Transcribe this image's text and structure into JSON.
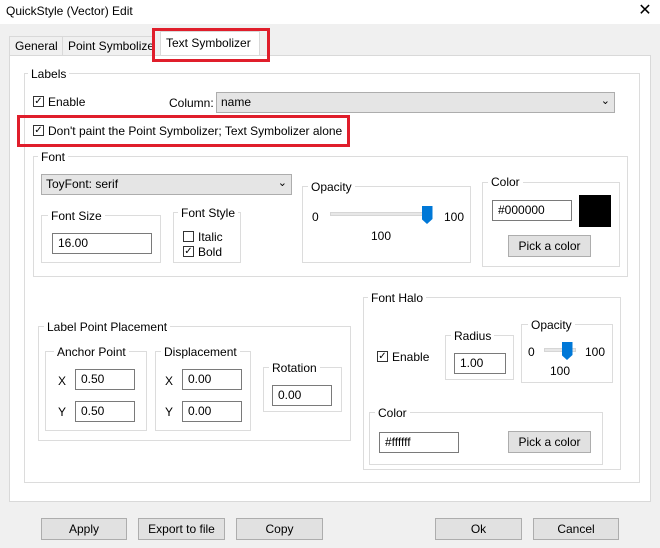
{
  "window": {
    "title": "QuickStyle (Vector) Edit",
    "close_glyph": "✕"
  },
  "tabs": [
    "General",
    "Point Symbolize",
    "Text Symbolizer"
  ],
  "labels": {
    "group_label": "Labels",
    "enable_label": "Enable",
    "enable_checked": true,
    "column_label": "Column:",
    "column_value": "name",
    "dont_paint_label": "Don't paint the Point Symbolizer; Text Symbolizer alone",
    "dont_paint_checked": true
  },
  "font": {
    "group_label": "Font",
    "font_value": "ToyFont: serif",
    "font_size_label": "Font Size",
    "font_size_value": "16.00",
    "font_style_label": "Font Style",
    "italic_label": "Italic",
    "italic_checked": false,
    "bold_label": "Bold",
    "bold_checked": true,
    "opacity_label": "Opacity",
    "opacity_min": "0",
    "opacity_max": "100",
    "opacity_value": "100",
    "color_label": "Color",
    "color_value": "#000000",
    "pick_color_label": "Pick a color"
  },
  "placement": {
    "group_label": "Label Point Placement",
    "anchor_label": "Anchor Point",
    "anchor_x_label": "X",
    "anchor_x_value": "0.50",
    "anchor_y_label": "Y",
    "anchor_y_value": "0.50",
    "displacement_label": "Displacement",
    "disp_x_label": "X",
    "disp_x_value": "0.00",
    "disp_y_label": "Y",
    "disp_y_value": "0.00",
    "rotation_label": "Rotation",
    "rotation_value": "0.00"
  },
  "halo": {
    "group_label": "Font Halo",
    "enable_label": "Enable",
    "enable_checked": true,
    "radius_label": "Radius",
    "radius_value": "1.00",
    "opacity_label": "Opacity",
    "opacity_min": "0",
    "opacity_max": "100",
    "opacity_value": "100",
    "color_label": "Color",
    "color_value": "#ffffff",
    "pick_color_label": "Pick a color"
  },
  "footer": {
    "apply": "Apply",
    "export": "Export to file",
    "copy": "Copy",
    "ok": "Ok",
    "cancel": "Cancel"
  },
  "colors": {
    "highlight": "#e01e2b",
    "slider_thumb": "#0078d7",
    "swatch": "#000000"
  },
  "icons": {
    "checkbox_check": "✓",
    "dropdown": "chevron-down-icon",
    "close": "close-icon"
  }
}
